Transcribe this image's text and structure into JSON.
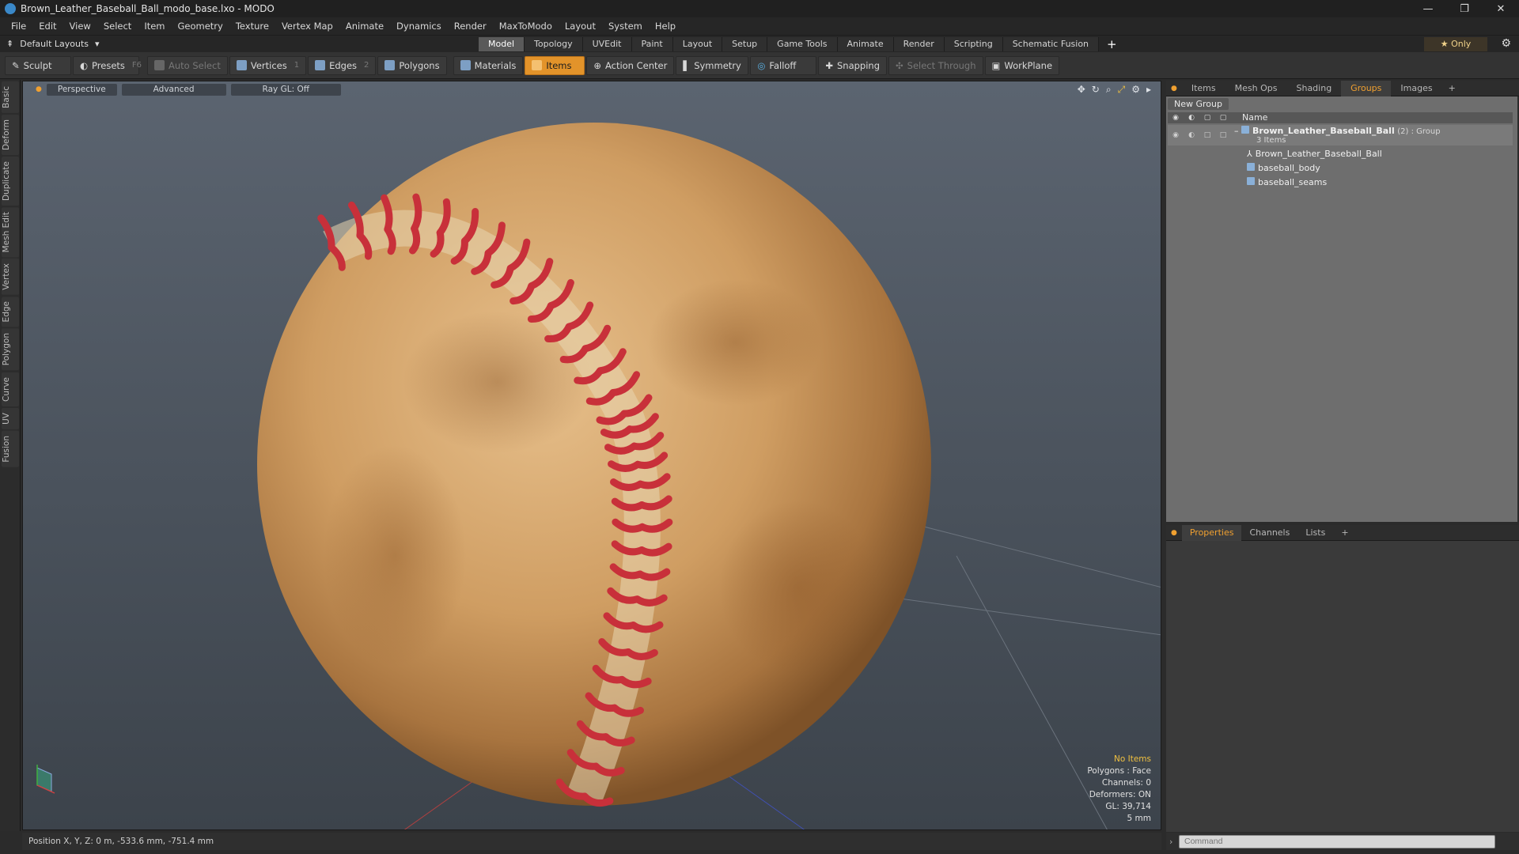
{
  "window": {
    "title": "Brown_Leather_Baseball_Ball_modo_base.lxo - MODO",
    "minimize": "—",
    "restore": "❐",
    "close": "✕"
  },
  "menu": [
    "File",
    "Edit",
    "View",
    "Select",
    "Item",
    "Geometry",
    "Texture",
    "Vertex Map",
    "Animate",
    "Dynamics",
    "Render",
    "MaxToModo",
    "Layout",
    "System",
    "Help"
  ],
  "layouts": {
    "label": "Default Layouts",
    "arrow": "▾"
  },
  "tabs": [
    {
      "label": "Model",
      "active": true
    },
    {
      "label": "Topology"
    },
    {
      "label": "UVEdit"
    },
    {
      "label": "Paint"
    },
    {
      "label": "Layout"
    },
    {
      "label": "Setup"
    },
    {
      "label": "Game Tools"
    },
    {
      "label": "Animate"
    },
    {
      "label": "Render"
    },
    {
      "label": "Scripting"
    },
    {
      "label": "Schematic Fusion"
    }
  ],
  "tabs_plus": "+",
  "only": "★  Only",
  "toolbar": {
    "sculpt": "Sculpt",
    "presets": "Presets",
    "presets_key": "F6",
    "auto_select": "Auto Select",
    "vertices": "Vertices",
    "vertices_key": "1",
    "edges": "Edges",
    "edges_key": "2",
    "polygons": "Polygons",
    "materials": "Materials",
    "items": "Items",
    "action_center": "Action Center",
    "symmetry": "Symmetry",
    "falloff": "Falloff",
    "snapping": "Snapping",
    "select_through": "Select Through",
    "workplane": "WorkPlane"
  },
  "left_tabs": [
    "Basic",
    "Deform",
    "Duplicate",
    "Mesh Edit",
    "Vertex",
    "Edge",
    "Polygon",
    "Curve",
    "UV",
    "Fusion"
  ],
  "viewport": {
    "perspective": "Perspective",
    "advanced": "Advanced",
    "raygl": "Ray GL: Off",
    "info": {
      "no_items": "No Items",
      "polygons": "Polygons : Face",
      "channels": "Channels: 0",
      "deformers": "Deformers: ON",
      "gl": "GL: 39,714",
      "scale": "5 mm"
    }
  },
  "right_tabs": [
    "Items",
    "Mesh Ops",
    "Shading",
    "Groups",
    "Images"
  ],
  "groups": {
    "new_group": "New Group",
    "name_header": "Name",
    "root": {
      "name": "Brown_Leather_Baseball_Ball",
      "suffix": "(2) : Group",
      "count": "3 Items"
    },
    "children": [
      "Brown_Leather_Baseball_Ball",
      "baseball_body",
      "baseball_seams"
    ]
  },
  "prop_tabs": [
    "Properties",
    "Channels",
    "Lists"
  ],
  "status": {
    "position": "Position X, Y, Z:  0 m, -533.6 mm, -751.4 mm"
  },
  "command": {
    "placeholder": "Command"
  }
}
